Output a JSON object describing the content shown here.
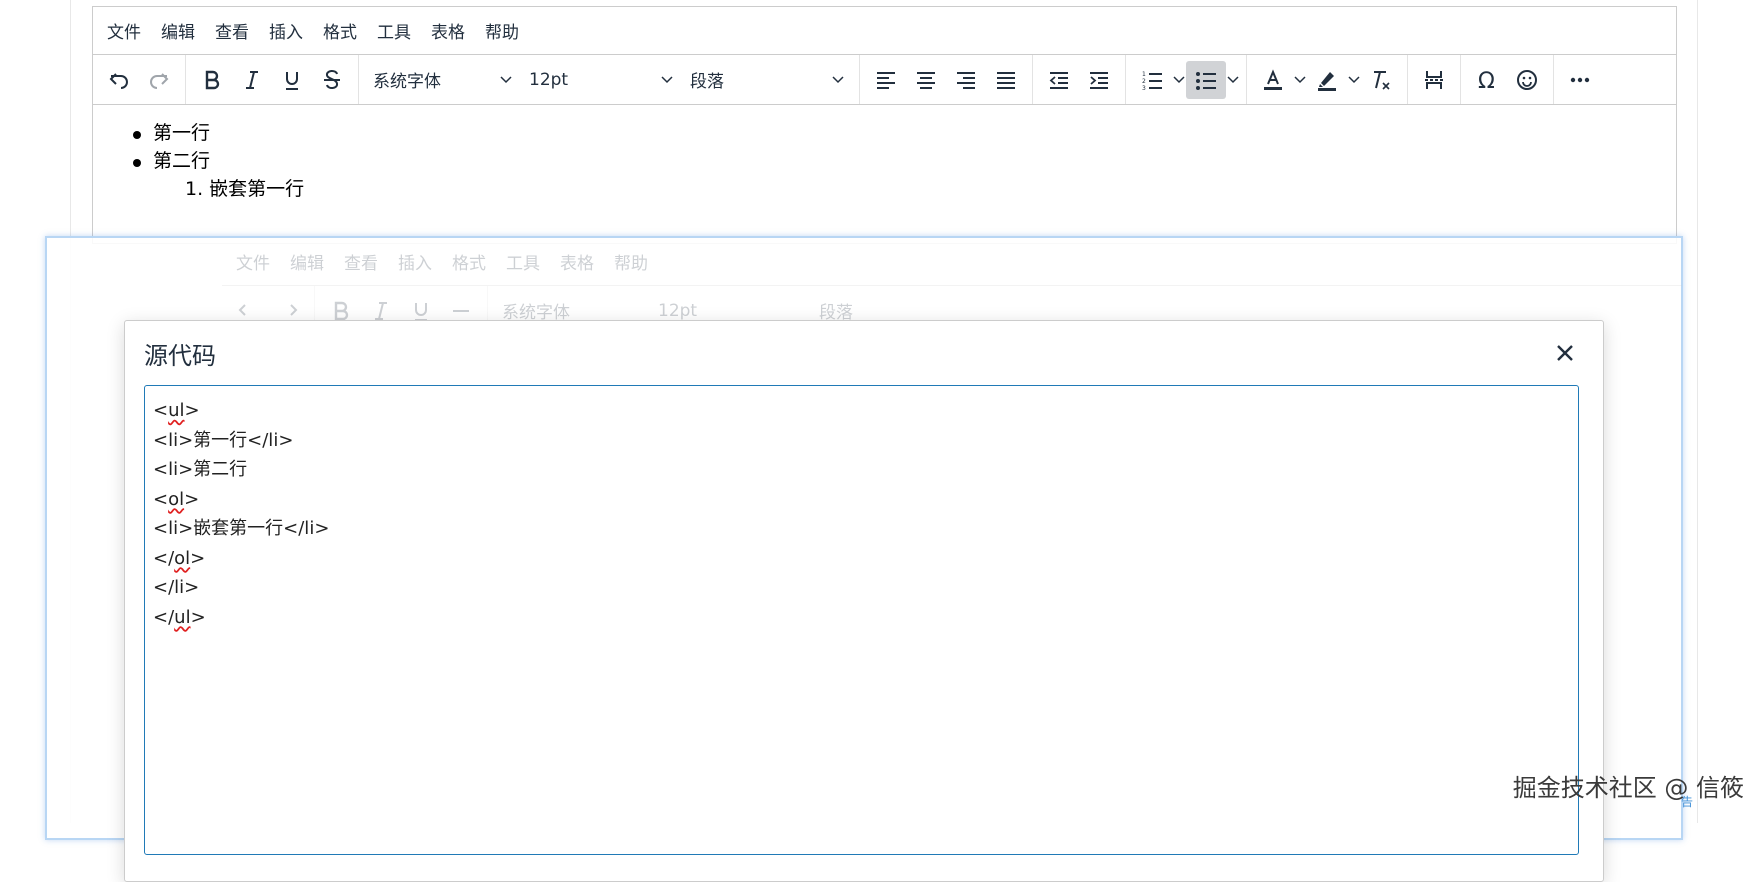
{
  "menu": [
    "文件",
    "编辑",
    "查看",
    "插入",
    "格式",
    "工具",
    "表格",
    "帮助"
  ],
  "toolbar": {
    "font_family": "系统字体",
    "font_size": "12pt",
    "block_format": "段落"
  },
  "content": {
    "items": [
      "第一行",
      "第二行"
    ],
    "nested_item": "1. 嵌套第一行"
  },
  "dialog": {
    "title": "源代码",
    "code_lines": [
      {
        "pre": "<",
        "mark": "ul",
        "post": ">"
      },
      {
        "pre": "<li>第一行</li>",
        "mark": "",
        "post": ""
      },
      {
        "pre": "<li>第二行",
        "mark": "",
        "post": ""
      },
      {
        "pre": "<",
        "mark": "ol",
        "post": ">"
      },
      {
        "pre": "<li>嵌套第一行</li>",
        "mark": "",
        "post": ""
      },
      {
        "pre": "</",
        "mark": "ol",
        "post": ">"
      },
      {
        "pre": "</li>",
        "mark": "",
        "post": ""
      },
      {
        "pre": "</",
        "mark": "ul",
        "post": ">"
      }
    ]
  },
  "watermark": "掘金技术社区 @ 信筱",
  "watermark_mark": "告",
  "colors": {
    "border": "#cccccc",
    "active_button": "#d1d3d6",
    "focus_border": "#207ab7",
    "overlay_border": "#b8d6f4"
  }
}
